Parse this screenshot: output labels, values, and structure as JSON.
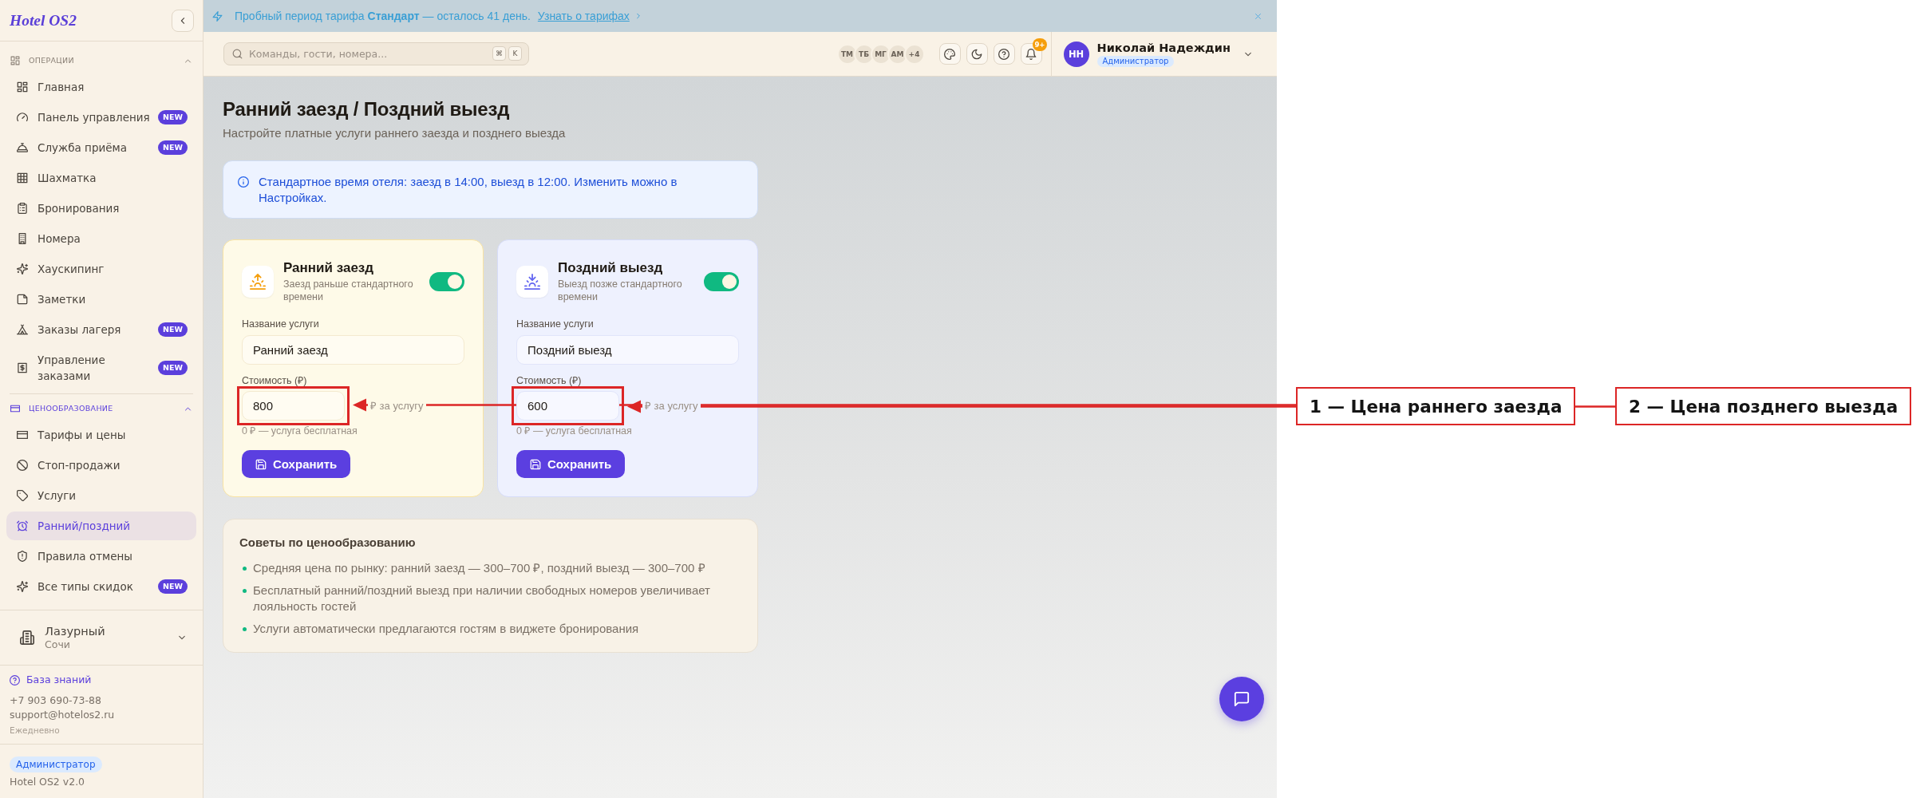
{
  "sidebar": {
    "logo": "Hotel OS2",
    "sections": [
      {
        "title": "ОПЕРАЦИИ",
        "expanded": true,
        "items": [
          {
            "label": "Главная",
            "selected": false
          },
          {
            "label": "Панель управления",
            "badge": "NEW",
            "selected": false
          },
          {
            "label": "Служба приёма",
            "badge": "NEW",
            "selected": false
          },
          {
            "label": "Шахматка",
            "selected": false
          },
          {
            "label": "Бронирования",
            "selected": false
          },
          {
            "label": "Номера",
            "selected": false
          },
          {
            "label": "Хаускипинг",
            "selected": false
          },
          {
            "label": "Заметки",
            "selected": false
          },
          {
            "label": "Заказы лагеря",
            "badge": "NEW",
            "selected": false
          },
          {
            "label": "Управление заказами",
            "badge": "NEW",
            "selected": false
          }
        ]
      },
      {
        "title": "ЦЕНООБРАЗОВАНИЕ",
        "expanded": true,
        "items": [
          {
            "label": "Тарифы и цены",
            "selected": false
          },
          {
            "label": "Стоп-продажи",
            "selected": false
          },
          {
            "label": "Услуги",
            "selected": false
          },
          {
            "label": "Ранний/поздний",
            "selected": true
          },
          {
            "label": "Правила отмены",
            "selected": false
          },
          {
            "label": "Все типы скидок",
            "badge": "NEW",
            "selected": false
          }
        ]
      }
    ],
    "property": {
      "name": "Лазурный",
      "city": "Сочи"
    },
    "support": {
      "link": "База знаний",
      "phone": "+7 903 690-73-88",
      "email": "support@hotelos2.ru",
      "hours": "Ежедневно"
    },
    "footer": {
      "role": "Администратор",
      "version": "Hotel OS2 v2.0"
    }
  },
  "banner": {
    "text": "Пробный период тарифа **Стандарт** — осталось 41 день.",
    "link": "Узнать о тарифах"
  },
  "topbar": {
    "search": {
      "placeholder": "Команды, гости, номера...",
      "keys": [
        "⌘",
        "K"
      ]
    },
    "online_users": [
      "ТМ",
      "ТБ",
      "МГ",
      "АМ",
      "+4"
    ],
    "notifications_badge": "9+",
    "user": {
      "initials": "НН",
      "name": "Николай Надеждин",
      "role": "Администратор"
    }
  },
  "page": {
    "title": "Ранний заезд / Поздний выезд",
    "subtitle": "Настройте платные услуги раннего заезда и позднего выезда",
    "info": "Стандартное время отеля: заезд в 14:00, выезд в 12:00. Изменить можно в Настройках."
  },
  "cards": [
    {
      "kind": "early",
      "title": "Ранний заезд",
      "description": "Заезд раньше стандартного времени",
      "on": true,
      "name_label": "Название услуги",
      "name_value": "Ранний заезд",
      "price_label": "Стоимость (₽)",
      "price_value": "800",
      "price_suffix": "₽ за услугу",
      "hint": "0 ₽ — услуга бесплатная",
      "save": "Сохранить"
    },
    {
      "kind": "late",
      "title": "Поздний выезд",
      "description": "Выезд позже стандартного времени",
      "on": true,
      "name_label": "Название услуги",
      "name_value": "Поздний выезд",
      "price_label": "Стоимость (₽)",
      "price_value": "600",
      "price_suffix": "₽ за услугу",
      "hint": "0 ₽ — услуга бесплатная",
      "save": "Сохранить"
    }
  ],
  "tips": {
    "title": "Советы по ценообразованию",
    "items": [
      "Средняя цена по рынку: ранний заезд — 300–700 ₽, поздний выезд — 300–700 ₽",
      "Бесплатный ранний/поздний выезд при наличии свободных номеров увеличивает лояльность гостей",
      "Услуги автоматически предлагаются гостям в виджете бронирования"
    ]
  },
  "annotations": [
    {
      "text": "1 — Цена раннего заезда"
    },
    {
      "text": "2 — Цена позднего выезда"
    }
  ]
}
